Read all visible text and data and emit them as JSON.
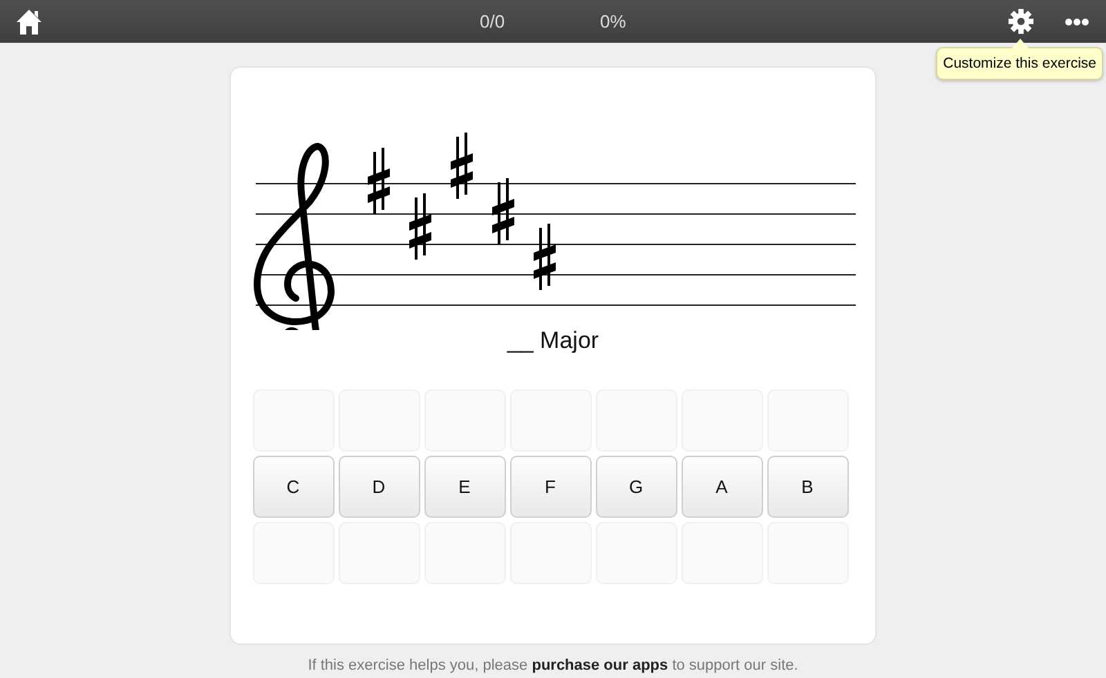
{
  "toolbar": {
    "score": "0/0",
    "percent": "0%"
  },
  "tooltip": {
    "text": "Customize this exercise"
  },
  "exercise": {
    "prompt": "__ Major"
  },
  "answers": [
    {
      "label": "C"
    },
    {
      "label": "D"
    },
    {
      "label": "E"
    },
    {
      "label": "F"
    },
    {
      "label": "G"
    },
    {
      "label": "A"
    },
    {
      "label": "B"
    }
  ],
  "footer": {
    "text": "If this exercise helps you, please **purchase our apps** to support our site."
  }
}
